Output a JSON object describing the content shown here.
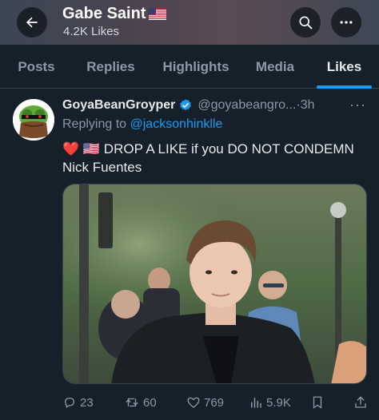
{
  "header": {
    "title": "Gabe Saint",
    "title_flag": "us-flag-emoji",
    "subtitle": "4.2K Likes",
    "back_icon": "arrow-left-icon",
    "search_icon": "search-icon",
    "more_icon": "more-horizontal-icon"
  },
  "tabs": [
    {
      "label": "Posts",
      "active": false
    },
    {
      "label": "Replies",
      "active": false
    },
    {
      "label": "Highlights",
      "active": false
    },
    {
      "label": "Media",
      "active": false
    },
    {
      "label": "Likes",
      "active": true
    }
  ],
  "tweet": {
    "author_name": "GoyaBeanGroyper",
    "verified": true,
    "handle": "@goyabeangro...",
    "separator": "·",
    "time": "3h",
    "more": "···",
    "replying_prefix": "Replying to",
    "replying_to": "@jacksonhinklle",
    "text_emojis": "❤️ 🇺🇸",
    "text_line1": "DROP A LIKE if you DO NOT CONDEMN",
    "text_line2": "Nick Fuentes",
    "media_alt": "photo of a young man in a black jacket outdoors"
  },
  "actions": {
    "replies": "23",
    "reposts": "60",
    "likes": "769",
    "views": "5.9K"
  },
  "colors": {
    "background": "#15202b",
    "accent": "#1d9bf0",
    "muted": "#8b98a5",
    "heart": "#f91880"
  }
}
